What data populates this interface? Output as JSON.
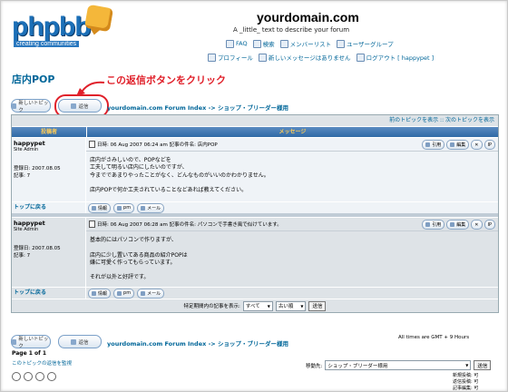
{
  "header": {
    "logo_text": "phpbb",
    "logo_tagline": "creating communities",
    "site_name": "yourdomain.com",
    "site_description": "A _little_ text to describe your forum",
    "nav_row1": [
      {
        "label": "FAQ",
        "icon": "faq-icon"
      },
      {
        "label": "検索",
        "icon": "search-icon"
      },
      {
        "label": "メンバーリスト",
        "icon": "memberlist-icon"
      },
      {
        "label": "ユーザーグループ",
        "icon": "usergroups-icon"
      }
    ],
    "nav_row2": [
      {
        "label": "プロフィール",
        "icon": "profile-icon"
      },
      {
        "label": "新しいメッセージはありません",
        "icon": "messages-icon"
      },
      {
        "label": "ログアウト [ happypet ]",
        "icon": "logout-icon"
      }
    ]
  },
  "topic_title": "店内POP",
  "annotation": "この返信ボタンをクリック",
  "buttons": {
    "new_topic": "新しいトピック",
    "reply": "返信"
  },
  "breadcrumb": "yourdomain.com Forum Index -> ショップ・ブリーダー様用",
  "topic_nav": "前のトピックを表示 :: 次のトピックを表示",
  "columns": {
    "author": "投稿者",
    "message": "メッセージ"
  },
  "posts": [
    {
      "username": "happypet",
      "rank": "Site Admin",
      "joined": "登録日: 2007.08.05",
      "post_count": "記事: 7",
      "meta": "日時: 06 Aug 2007 06:24 am    記事の件名: 店内POP",
      "body": "店内がさみしいので、POPなどを\n工夫して明るい店内にしたいのですが、\n今までであまりやったことがなく、どんなものがいいのかわかりません。\n\n店内POPで何か工夫されていることなどあれば教えてください。",
      "quote": "引用",
      "edit": "編集",
      "back_to_top": "トップに戻る",
      "profile": "情報",
      "pm": "pm",
      "email": "メール"
    },
    {
      "username": "happypet",
      "rank": "Site Admin",
      "joined": "登録日: 2007.08.05",
      "post_count": "記事: 7",
      "meta": "日時: 06 Aug 2007 06:28 am    記事の件名: パソコンで手書き風で似けています。",
      "body": "基本的にはパソコンで作りますが、\n\n店内に少し置いてある商品の紹介POPは\n嫌に可愛く作ってもらっています。\n\nそれが以外と好評です。",
      "quote": "引用",
      "edit": "編集",
      "back_to_top": "トップに戻る",
      "profile": "情報",
      "pm": "pm",
      "email": "メール"
    }
  ],
  "filter": {
    "label": "特定期間内の記事を表示:",
    "period": "すべて",
    "order": "古い順",
    "go": "送信"
  },
  "timezone": "All times are GMT + 9 Hours",
  "pagination": "Page 1 of 1",
  "watch_link": "このトピックの返信を監視",
  "jump": {
    "label": "移動先:",
    "selected": "ショップ・ブリーダー様用",
    "go": "送信"
  },
  "permissions": [
    "新規投稿: 可",
    "返信投稿: 可",
    "記事編集: 可"
  ]
}
